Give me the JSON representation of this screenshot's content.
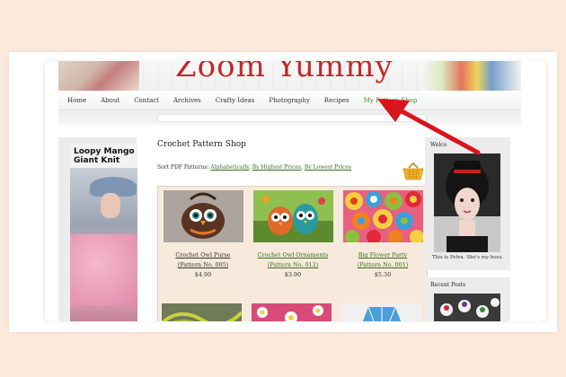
{
  "site": {
    "title": "Zoom Yummy"
  },
  "nav": {
    "items": [
      {
        "label": "Home"
      },
      {
        "label": "About"
      },
      {
        "label": "Contact"
      },
      {
        "label": "Archives"
      },
      {
        "label": "Crafty Ideas"
      },
      {
        "label": "Photography"
      },
      {
        "label": "Recipes"
      },
      {
        "label": "My Pattern Shop"
      }
    ],
    "active_color": "#4c8a2c"
  },
  "ad": {
    "headline": "Loopy Mango Giant Knit"
  },
  "main": {
    "heading": "Crochet Pattern Shop",
    "sort_prefix": "Sort PDF Patterns:",
    "sort_options": [
      {
        "label": "Alphabetically"
      },
      {
        "label": "By Highest Prices"
      },
      {
        "label": "By Lowest Prices"
      }
    ],
    "sort_sep": ", ",
    "basket_icon": "shopping-basket-icon",
    "products": [
      {
        "name": "Crochet Owl Purse",
        "pattern": "(Pattern No. 005)",
        "price": "$4.90"
      },
      {
        "name": "Crochet Owl Ornaments",
        "pattern": "(Pattern No. 012)",
        "price": "$3.90"
      },
      {
        "name": "Big Flower Party",
        "pattern": "(Pattern No. 001)",
        "price": "$5.30"
      }
    ]
  },
  "sidebar": {
    "welcome_title": "Welco",
    "welcome_caption": "This is Petra. She's my boss.",
    "recent_title": "Recent Posts"
  },
  "colors": {
    "brand_red": "#c2282a",
    "link_green": "#3b6f1e",
    "arrow_red": "#d8151b",
    "background": "#fbe9dc"
  }
}
